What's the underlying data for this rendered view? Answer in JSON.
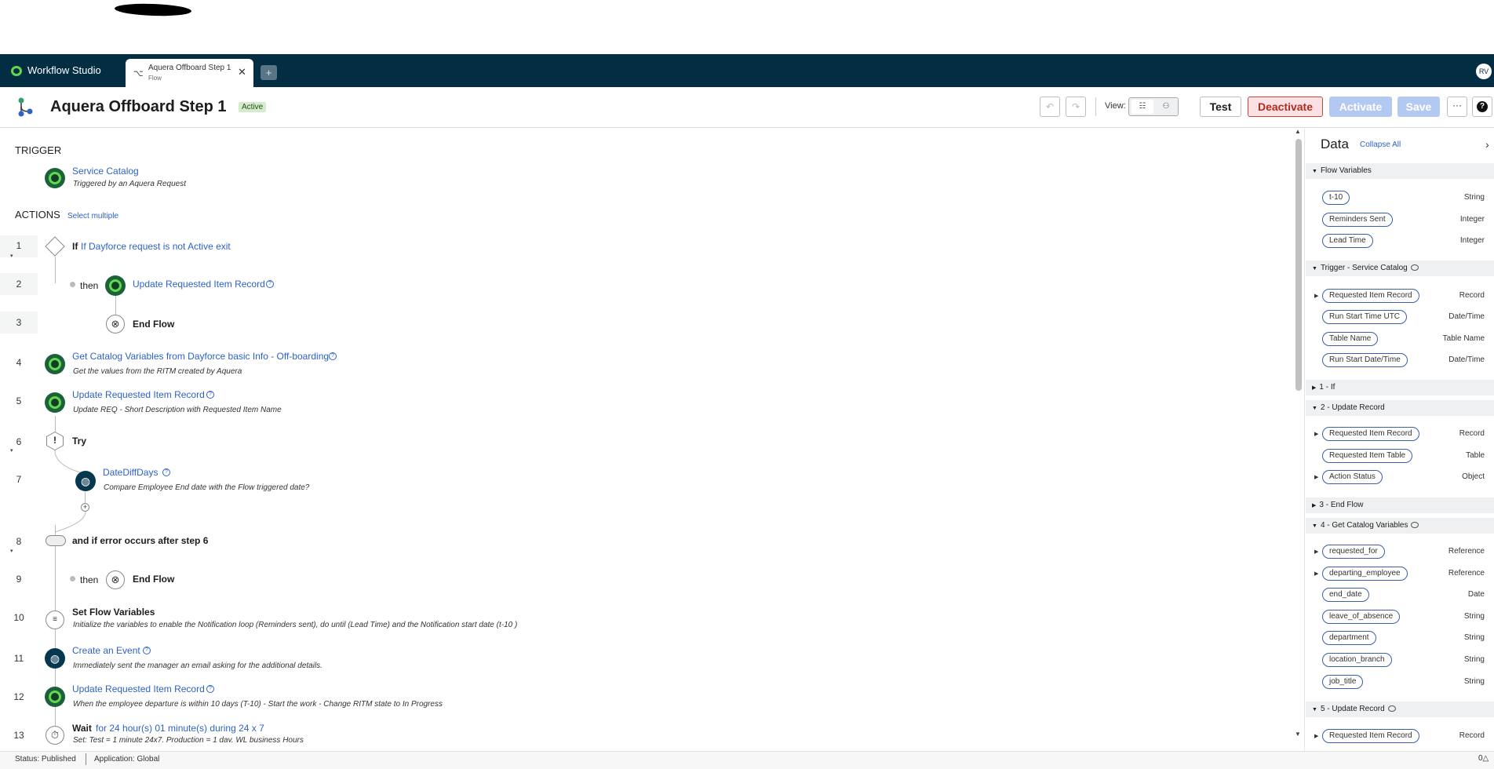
{
  "studio": {
    "title": "Workflow Studio",
    "new_tab": "+",
    "avatar": "RV"
  },
  "tab": {
    "title": "Aquera Offboard Step 1",
    "subtitle": "Flow",
    "close": "✕"
  },
  "header": {
    "title": "Aquera Offboard Step 1",
    "status_badge": "Active",
    "view_label": "View:",
    "test": "Test",
    "deactivate": "Deactivate",
    "activate": "Activate",
    "save": "Save",
    "more": "···",
    "help": "?"
  },
  "trigger": {
    "section_label": "TRIGGER",
    "title": "Service Catalog",
    "desc": "Triggered by an Aquera Request"
  },
  "actions": {
    "section_label": "ACTIONS",
    "select_multiple": "Select multiple",
    "steps": [
      {
        "num": "1",
        "prefix": "If",
        "title": "If Dayforce request is not Active exit"
      },
      {
        "num": "2",
        "then": "then",
        "title": "Update Requested Item Record"
      },
      {
        "num": "3",
        "title": "End Flow"
      },
      {
        "num": "4",
        "title": "Get Catalog Variables from Dayforce basic Info - Off-boarding",
        "desc": "Get the values from the RITM created by Aquera"
      },
      {
        "num": "5",
        "title": "Update Requested Item Record",
        "desc": "Update REQ - Short Description with Requested Item Name"
      },
      {
        "num": "6",
        "title": "Try"
      },
      {
        "num": "7",
        "title": "DateDiffDays",
        "desc": "Compare Employee End date with the Flow triggered date?"
      },
      {
        "num": "8",
        "title": "and if error occurs after step 6"
      },
      {
        "num": "9",
        "then": "then",
        "title": "End Flow"
      },
      {
        "num": "10",
        "title": "Set Flow Variables",
        "desc": "Initialize the variables to enable the Notification loop (Reminders sent), do until (Lead Time) and the Notification start date (t-10 )"
      },
      {
        "num": "11",
        "title": "Create an Event",
        "desc": "Immediately sent the manager an email asking for the additional details."
      },
      {
        "num": "12",
        "title": "Update Requested Item Record",
        "desc": "When the employee departure is within 10 days (T-10) - Start the work - Change RITM state to In Progress"
      },
      {
        "num": "13",
        "prefix": "Wait",
        "title": "for 24 hour(s) 01 minute(s) during 24 x 7",
        "desc": "Set: Test = 1 minute 24x7, Production = 1 day, WL business Hours"
      }
    ]
  },
  "data_panel": {
    "title": "Data",
    "collapse_all": "Collapse All",
    "close": "›",
    "sections": [
      {
        "label": "Flow Variables",
        "items": [
          {
            "name": "t-10",
            "type": "String"
          },
          {
            "name": "Reminders Sent",
            "type": "Integer"
          },
          {
            "name": "Lead Time",
            "type": "Integer"
          }
        ]
      },
      {
        "label": "Trigger - Service Catalog",
        "items": [
          {
            "name": "Requested Item Record",
            "type": "Record"
          },
          {
            "name": "Run Start Time UTC",
            "type": "Date/Time"
          },
          {
            "name": "Table Name",
            "type": "Table Name"
          },
          {
            "name": "Run Start Date/Time",
            "type": "Date/Time"
          }
        ]
      },
      {
        "label": "1 - If"
      },
      {
        "label": "2 - Update Record",
        "items": [
          {
            "name": "Requested Item Record",
            "type": "Record"
          },
          {
            "name": "Requested Item Table",
            "type": "Table"
          },
          {
            "name": "Action Status",
            "type": "Object"
          }
        ]
      },
      {
        "label": "3 - End Flow"
      },
      {
        "label": "4 - Get Catalog Variables",
        "items": [
          {
            "name": "requested_for",
            "type": "Reference"
          },
          {
            "name": "departing_employee",
            "type": "Reference"
          },
          {
            "name": "end_date",
            "type": "Date"
          },
          {
            "name": "leave_of_absence",
            "type": "String"
          },
          {
            "name": "department",
            "type": "String"
          },
          {
            "name": "location_branch",
            "type": "String"
          },
          {
            "name": "job_title",
            "type": "String"
          }
        ]
      },
      {
        "label": "5 - Update Record",
        "items": [
          {
            "name": "Requested Item Record",
            "type": "Record"
          }
        ]
      }
    ]
  },
  "status_bar": {
    "status": "Status: Published",
    "application": "Application: Global",
    "notifications": "0△"
  }
}
